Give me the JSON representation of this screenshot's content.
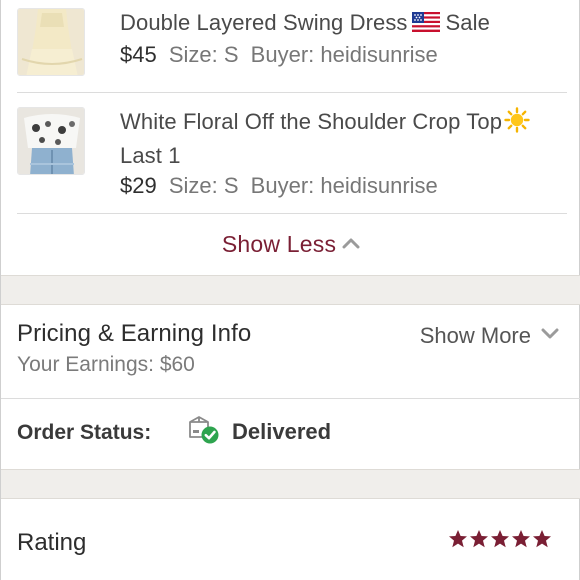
{
  "items": [
    {
      "title": "Double Layered Swing Dress",
      "flag_icon": "us-flag-icon",
      "title_suffix": "Sale",
      "price": "$45",
      "size": "Size: S",
      "buyer": "Buyer: heidisunrise",
      "thumb_color": "#f3e9c6"
    },
    {
      "title": "White Floral Off the Shoulder Crop Top",
      "sun_icon": "sun-icon",
      "title_line2": "Last 1",
      "price": "$29",
      "size": "Size: S",
      "buyer": "Buyer: heidisunrise",
      "thumb_color": "#f4f4f2"
    }
  ],
  "show_less": {
    "label": "Show Less",
    "icon": "chevron-up-icon",
    "color": "#7a1f34"
  },
  "pricing": {
    "title": "Pricing & Earning Info",
    "earnings": "Your Earnings: $60",
    "show_more_label": "Show More",
    "show_more_icon": "chevron-down-icon"
  },
  "order_status": {
    "label": "Order Status:",
    "icon": "delivered-box-icon",
    "value": "Delivered",
    "check_color": "#2ea44f"
  },
  "rating": {
    "label": "Rating",
    "stars": 5,
    "max_stars": 5,
    "star_color": "#7a1f34"
  }
}
